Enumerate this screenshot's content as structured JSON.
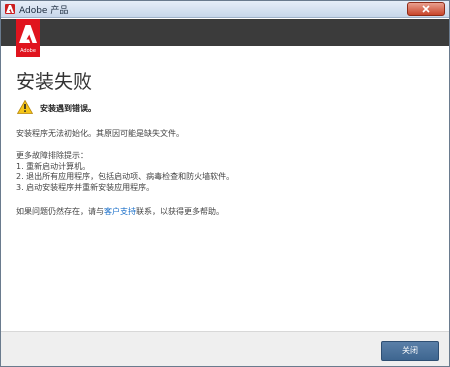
{
  "window": {
    "title": "Adobe 产品",
    "logo_text": "Adobe"
  },
  "main": {
    "heading": "安装失败",
    "warning": "安装遇到错误。",
    "description": "安装程序无法初始化。其原因可能是缺失文件。",
    "tips_title": "更多故障排除提示：",
    "tips": [
      "1. 重新启动计算机。",
      "2. 退出所有应用程序，包括启动项、病毒检查和防火墙软件。",
      "3. 启动安装程序并重新安装应用程序。"
    ],
    "contact_prefix": "如果问题仍然存在，请与",
    "contact_link": "客户支持",
    "contact_suffix": "联系，以获得更多帮助。"
  },
  "footer": {
    "close_label": "关闭"
  },
  "colors": {
    "adobe_red": "#e0141e",
    "header_dark": "#3b3b3b",
    "link_blue": "#1a6fc9",
    "button_blue": "#4a719b"
  }
}
